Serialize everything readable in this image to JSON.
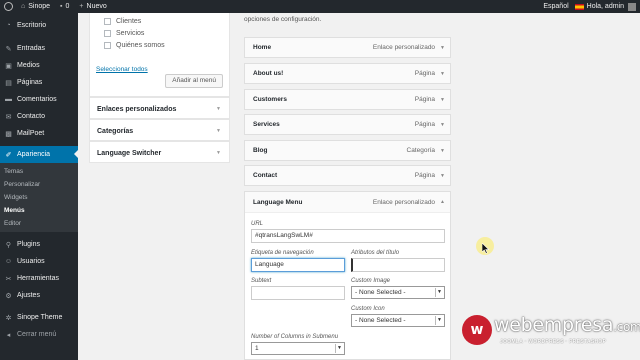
{
  "adminbar": {
    "site_name": "Sinope",
    "comments_count": "0",
    "new_label": "Nuevo",
    "language": "Español",
    "greeting": "Hola, admin"
  },
  "sidebar": {
    "items_top": [
      {
        "label": "Escritorio",
        "icon": "dashboard-icon"
      },
      {
        "label": "Entradas",
        "icon": "pin-icon"
      },
      {
        "label": "Medios",
        "icon": "media-icon"
      },
      {
        "label": "Páginas",
        "icon": "pages-icon"
      },
      {
        "label": "Comentarios",
        "icon": "comments-icon"
      },
      {
        "label": "Contacto",
        "icon": "mail-icon"
      },
      {
        "label": "MailPoet",
        "icon": "mailpoet-icon"
      }
    ],
    "active": {
      "label": "Apariencia",
      "icon": "brush-icon"
    },
    "submenu": [
      "Temas",
      "Personalizar",
      "Widgets",
      "Menús",
      "Editor"
    ],
    "items_bottom": [
      {
        "label": "Plugins",
        "icon": "plugin-icon"
      },
      {
        "label": "Usuarios",
        "icon": "users-icon"
      },
      {
        "label": "Herramientas",
        "icon": "tools-icon"
      },
      {
        "label": "Ajustes",
        "icon": "settings-icon"
      }
    ],
    "theme": {
      "label": "Sinope Theme",
      "icon": "gear-icon"
    },
    "collapse": {
      "label": "Cerrar menú",
      "icon": "collapse-icon"
    }
  },
  "pages_panel": {
    "pages": [
      "Clientes",
      "Servicios",
      "Quiénes somos"
    ],
    "select_all": "Seleccionar todos",
    "add_button": "Añadir al menú"
  },
  "accordions": [
    "Enlaces personalizados",
    "Categorías",
    "Language Switcher"
  ],
  "structure": {
    "description": "opciones de configuración.",
    "items": [
      {
        "title": "Home",
        "type": "Enlace personalizado"
      },
      {
        "title": "About us!",
        "type": "Página"
      },
      {
        "title": "Customers",
        "type": "Página"
      },
      {
        "title": "Services",
        "type": "Página"
      },
      {
        "title": "Blog",
        "type": "Categoría"
      },
      {
        "title": "Contact",
        "type": "Página"
      }
    ],
    "expanded": {
      "title": "Language Menu",
      "type": "Enlace personalizado",
      "url_label": "URL",
      "url_value": "#qtransLangSwLM#",
      "nav_label": "Etiqueta de navegación",
      "nav_value": "Language",
      "title_attr_label": "Atributos del título",
      "title_attr_value": "",
      "subtext_label": "Subtext",
      "subtext_value": "",
      "custom_image_label": "Custom Image",
      "custom_image_value": "- None Selected -",
      "custom_icon_label": "Custom Icon",
      "custom_icon_value": "- None Selected -",
      "columns_label": "Number of Columns in Submenu",
      "columns_value": "1"
    }
  },
  "watermark": {
    "brand": "webempresa",
    "domain": ".com",
    "tagline": "JOOMLA · WORDPRESS · PRESTASHOP",
    "logo_letter": "w"
  },
  "colors": {
    "admin_dark": "#23282d",
    "accent": "#0073aa",
    "watermark_red": "#c9202f"
  }
}
